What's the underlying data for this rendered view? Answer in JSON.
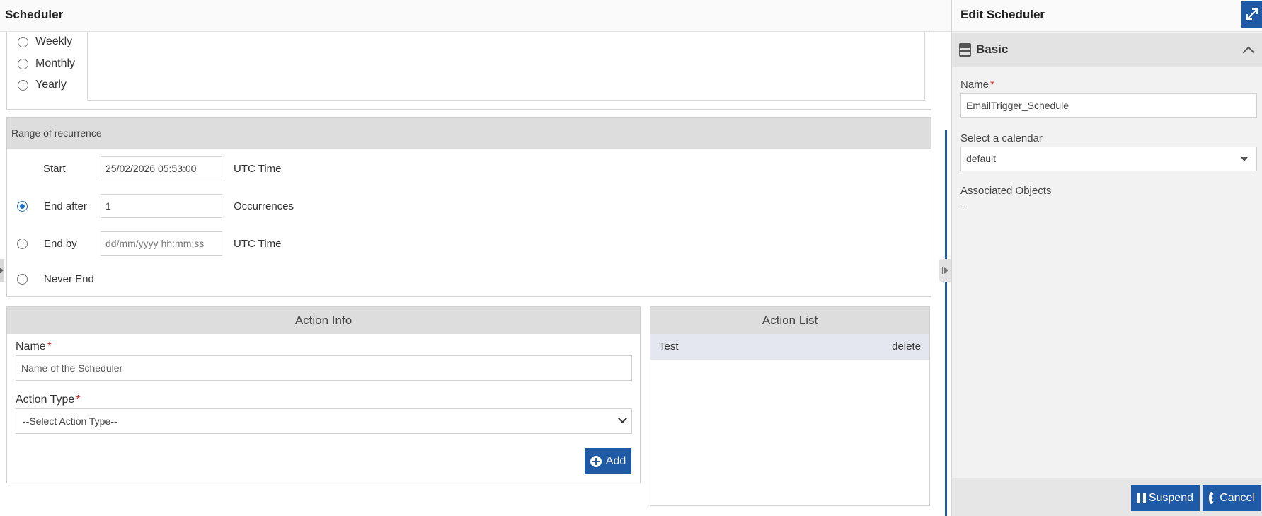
{
  "main": {
    "title": "Scheduler",
    "frequencies": [
      {
        "label": "Weekly",
        "selected": false
      },
      {
        "label": "Monthly",
        "selected": false
      },
      {
        "label": "Yearly",
        "selected": false
      }
    ],
    "range": {
      "header": "Range of recurrence",
      "start": {
        "label": "Start",
        "value": "25/02/2026 05:53:00",
        "unit": "UTC Time"
      },
      "end_after": {
        "label": "End after",
        "value": "1",
        "unit": "Occurrences",
        "selected": true
      },
      "end_by": {
        "label": "End by",
        "placeholder": "dd/mm/yyyy hh:mm:ss",
        "unit": "UTC Time",
        "selected": false
      },
      "never_end": {
        "label": "Never End",
        "selected": false
      }
    },
    "action_info": {
      "title": "Action Info",
      "name_label": "Name",
      "name_placeholder": "Name of the Scheduler",
      "type_label": "Action Type",
      "type_value": "--Select Action Type--",
      "required_mark": "*",
      "add_label": "Add"
    },
    "action_list": {
      "title": "Action List",
      "items": [
        {
          "name": "Test",
          "action": "delete"
        }
      ]
    }
  },
  "edit_panel": {
    "title": "Edit Scheduler",
    "section": "Basic",
    "name_label": "Name",
    "name_value": "EmailTrigger_Schedule",
    "calendar_label": "Select a calendar",
    "calendar_value": "default",
    "assoc_label": "Associated Objects",
    "assoc_value": "-",
    "suspend_label": "Suspend",
    "cancel_label": "Cancel"
  },
  "colors": {
    "accent": "#1f5aa6",
    "header_bg": "#dddddd",
    "required": "#c62828"
  }
}
